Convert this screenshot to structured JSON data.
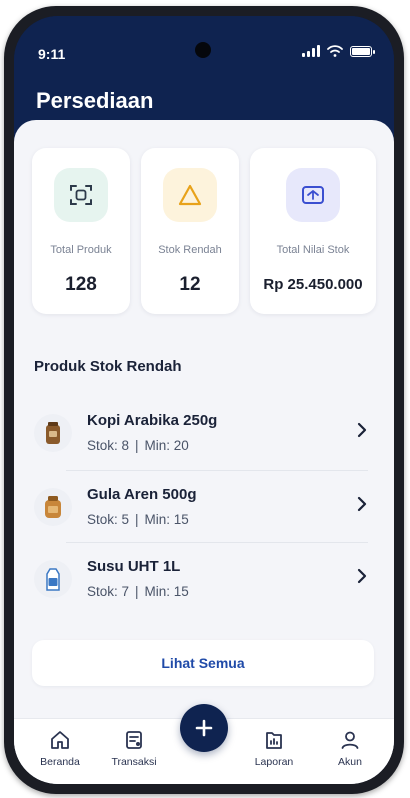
{
  "status_bar": {
    "time": "9:11"
  },
  "header": {
    "title": "Persediaan"
  },
  "summary_cards": [
    {
      "label": "Total Produk",
      "value": "128",
      "icon": "scan-icon",
      "accent": "#e6f4ef"
    },
    {
      "label": "Stok Rendah",
      "value": "12",
      "icon": "warning-icon",
      "accent": "#fdf3dc"
    },
    {
      "label": "Total Nilai Stok",
      "value": "Rp 25.450.000",
      "icon": "box-icon",
      "accent": "#e7e8fb"
    }
  ],
  "low_stock": {
    "title": "Produk Stok Rendah",
    "items": [
      {
        "name": "Kopi Arabika 250g",
        "stock": "Stok: 8",
        "min": "Min: 20"
      },
      {
        "name": "Gula Aren 500g",
        "stock": "Stok: 5",
        "min": "Min: 15"
      },
      {
        "name": "Susu UHT 1L",
        "stock": "Stok: 7",
        "min": "Min: 15"
      }
    ],
    "separator": "|",
    "see_all_label": "Lihat Semua"
  },
  "tabbar": {
    "items": [
      {
        "label": "Beranda",
        "icon": "home-icon"
      },
      {
        "label": "Transaksi",
        "icon": "receipt-icon"
      },
      {
        "label": "Laporan",
        "icon": "report-icon"
      },
      {
        "label": "Akun",
        "icon": "user-icon"
      }
    ],
    "fab_icon": "plus-icon"
  },
  "colors": {
    "primary": "#0f2350",
    "link": "#1f4aa8",
    "background": "#f4f5f9"
  }
}
